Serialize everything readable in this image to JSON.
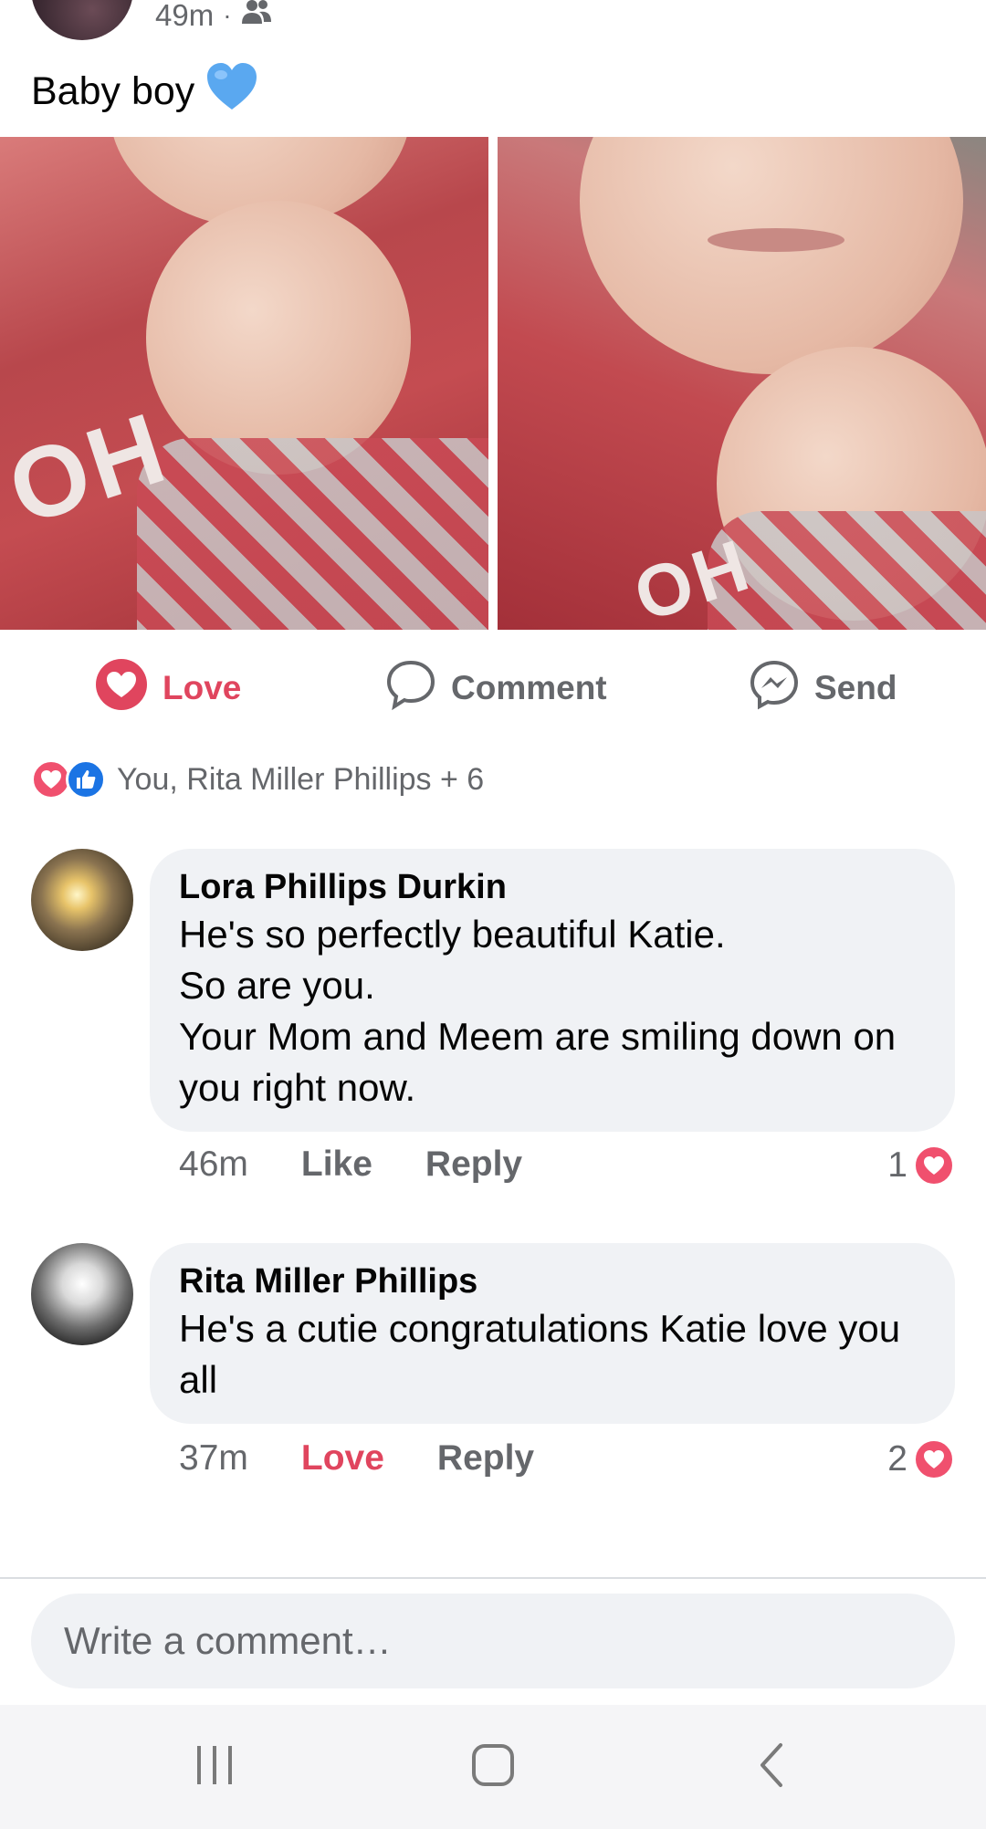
{
  "post": {
    "time": "49m",
    "audience_icon": "friends-icon",
    "text": "Baby boy",
    "emoji": "💙"
  },
  "actions": {
    "love_label": "Love",
    "comment_label": "Comment",
    "send_label": "Send"
  },
  "reactions": {
    "summary": "You, Rita Miller Phillips + 6",
    "icons": [
      "love-icon",
      "like-icon"
    ]
  },
  "comments": [
    {
      "author": "Lora Phillips Durkin",
      "text": "He's so perfectly beautiful Katie.\nSo are you.\nYour Mom and Meem are smiling down on you right now.",
      "time": "46m",
      "reaction_label": "Like",
      "reply_label": "Reply",
      "reaction_count": "1"
    },
    {
      "author": "Rita Miller Phillips",
      "text": "He's a cutie congratulations Katie love you all",
      "time": "37m",
      "reaction_label": "Love",
      "reply_label": "Reply",
      "reaction_count": "2"
    }
  ],
  "composer": {
    "placeholder": "Write a comment…"
  },
  "colors": {
    "love_red": "#e0455e",
    "like_blue": "#1b74e4",
    "bubble_bg": "#f0f2f5",
    "secondary_text": "#65676b"
  }
}
